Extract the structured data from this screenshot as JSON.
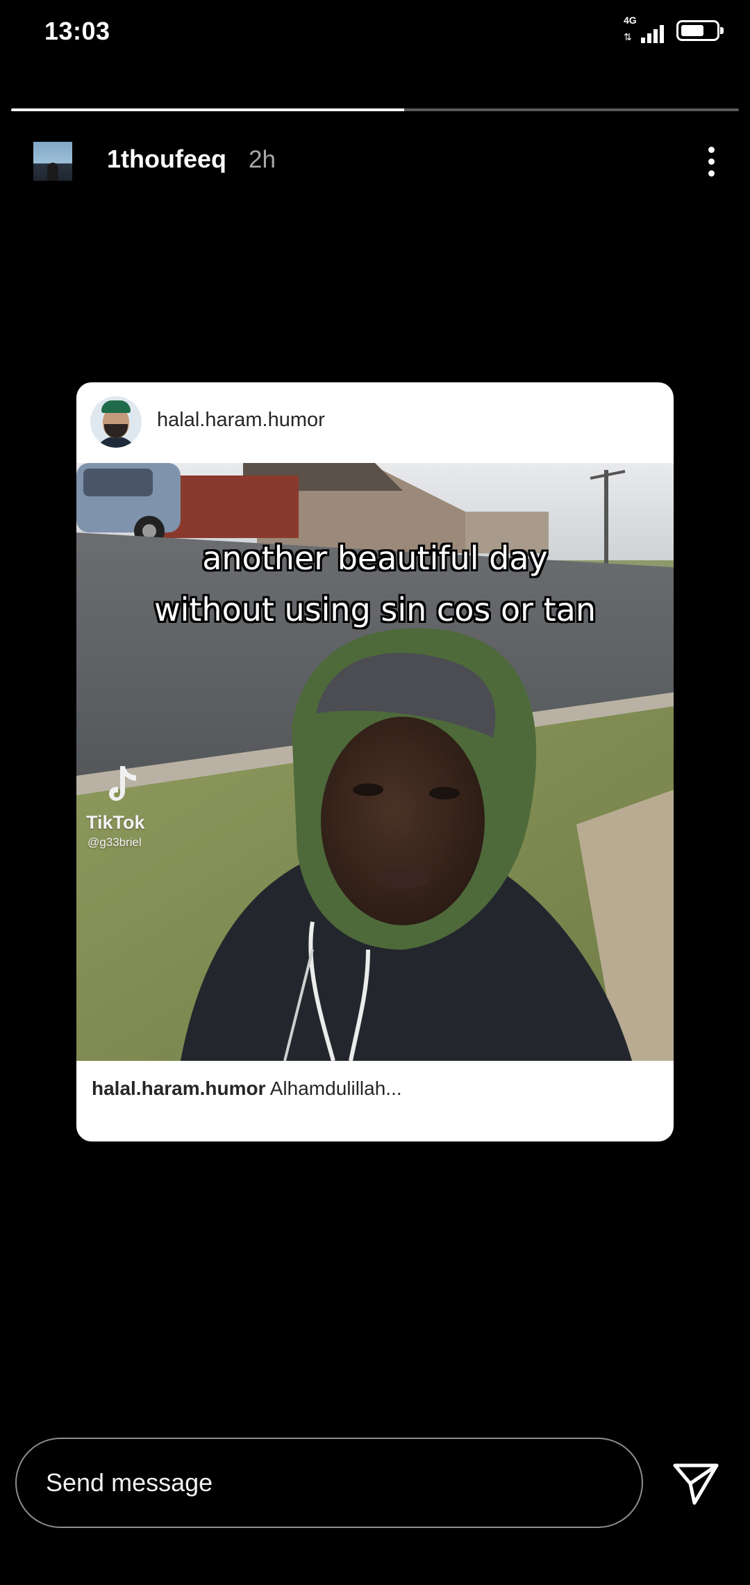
{
  "status_bar": {
    "time": "13:03",
    "network_type": "4G",
    "battery_level": 0.72
  },
  "story": {
    "progress": 0.54,
    "username": "1thoufeeq",
    "time_ago": "2h"
  },
  "shared_post": {
    "account": "halal.haram.humor",
    "meme_caption_line1": "another beautiful day",
    "meme_caption_line2": "without using sin cos or tan",
    "watermark_brand": "TikTok",
    "watermark_handle": "@g33briel",
    "caption_account": "halal.haram.humor",
    "caption_text": "Alhamdulillah..."
  },
  "message_bar": {
    "placeholder": "Send message"
  },
  "icons": {
    "more": "more-vertical-icon",
    "send": "paper-plane-icon",
    "signal": "signal-icon",
    "battery": "battery-icon"
  }
}
